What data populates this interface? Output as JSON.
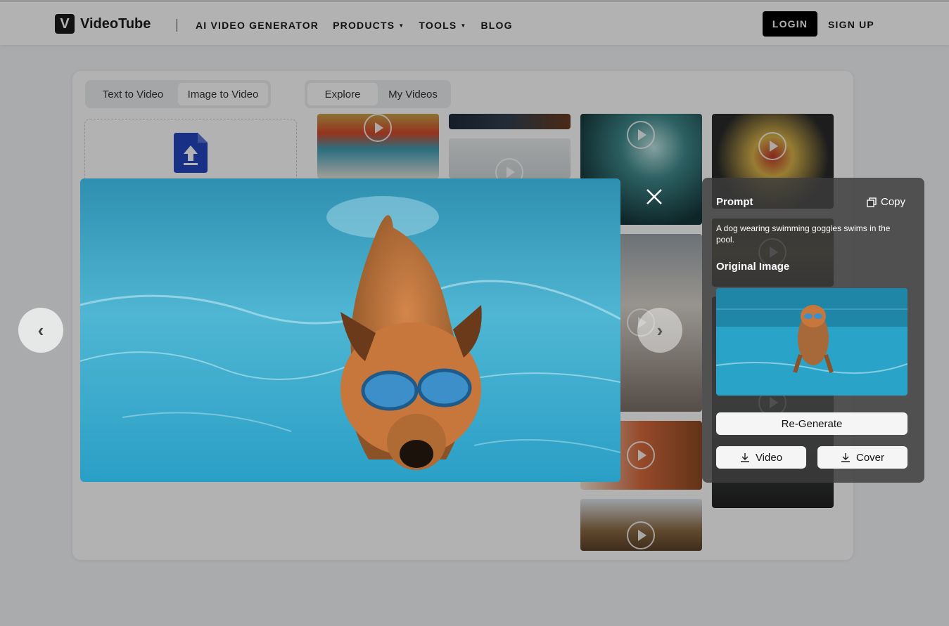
{
  "header": {
    "logo_mark": "V",
    "logo_text": "VideoTube",
    "nav": [
      {
        "label": "AI VIDEO GENERATOR",
        "dropdown": false
      },
      {
        "label": "PRODUCTS",
        "dropdown": true
      },
      {
        "label": "TOOLS",
        "dropdown": true
      },
      {
        "label": "BLOG",
        "dropdown": false
      }
    ],
    "login_label": "LOGIN",
    "signup_label": "SIGN UP"
  },
  "mode_tabs": [
    {
      "label": "Text to Video",
      "active": false
    },
    {
      "label": "Image to Video",
      "active": true
    }
  ],
  "view_tabs": [
    {
      "label": "Explore",
      "active": true
    },
    {
      "label": "My Videos",
      "active": false
    }
  ],
  "modal": {
    "prev_label": "‹",
    "next_label": "›",
    "prompt_title": "Prompt",
    "copy_label": "Copy",
    "prompt_text": "A dog wearing swimming goggles swims in the pool.",
    "original_image_title": "Original Image",
    "regenerate_label": "Re-Generate",
    "download_video_label": "Video",
    "download_cover_label": "Cover"
  },
  "colors": {
    "accent_dark": "#000000",
    "upload_blue": "#2346c0",
    "pool_blue": "#2aa3c9"
  }
}
